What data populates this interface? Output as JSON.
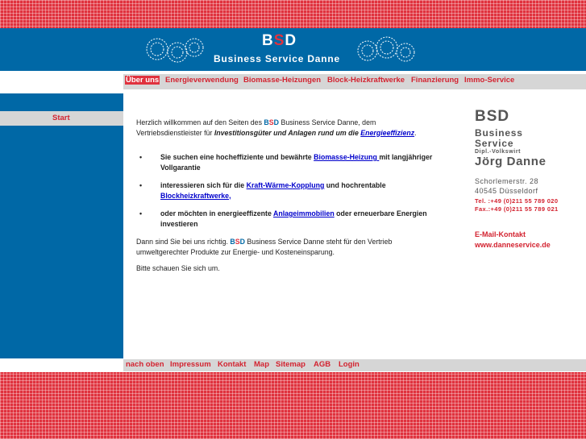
{
  "header": {
    "logo_b": "B",
    "logo_s": "S",
    "logo_d": "D",
    "company": "Business Service Danne"
  },
  "nav": {
    "items": [
      "Über uns",
      "Energieverwendung",
      "Biomasse-Heizungen",
      "Block-Heizkraftwerke",
      "Finanzierung",
      "Immo-Service"
    ],
    "active": "Über uns"
  },
  "sidebar": {
    "start": "Start"
  },
  "content": {
    "intro_1": "Herzlich willkommen auf den Seiten des ",
    "intro_bsd_b": "B",
    "intro_bsd_s": "S",
    "intro_bsd_d": "D",
    "intro_2": " Business Service Danne, dem Vertriebsdienstleister für ",
    "intro_em": "Investitionsgüter und Anlagen rund um die ",
    "intro_link": "Energieeffizienz",
    "intro_end": ".",
    "bullet": "•",
    "b1_pre": "Sie suchen eine hocheffiziente und bewährte ",
    "b1_link": "Biomasse-Heizung ",
    "b1_post": "mit langjähriger Vollgarantie",
    "b2_pre": "interessieren sich für die ",
    "b2_link1": "Kraft-Wärme-Kopplung",
    "b2_mid": " und hochrentable ",
    "b2_link2": "Blockheizkraftwerke,",
    "b3_pre": "oder möchten in energieeffizente ",
    "b3_link": "Anlageimmobilien",
    "b3_post": " oder erneuerbare Energien investieren",
    "p2_pre": "Dann sind Sie bei uns richtig. ",
    "p2_bsd_b": "B",
    "p2_bsd_s": "S",
    "p2_bsd_d": "D",
    "p2_post": " Business Service Danne steht für den Vertrieb umweltgerechter Produkte zur Energie- und Kosteneinsparung.",
    "p3": "Bitte schauen Sie sich um."
  },
  "contact": {
    "bsd": "BSD",
    "business": "Business",
    "service": "Service",
    "title": "Dipl.-Volkswirt",
    "name": "Jörg Danne",
    "street": "Schorlemerstr. 28",
    "city": "40545 Düsseldorf",
    "tel": "Tel. :+49 (0)211 55 789 020",
    "fax": "Fax.:+49 (0)211 55 789 021",
    "email_label": "E-Mail-Kontakt",
    "web": "www.danneservice.de"
  },
  "footer": {
    "items": [
      "nach oben",
      "Impressum",
      "Kontakt",
      "Map",
      "Sitemap",
      "AGB",
      "Login"
    ]
  },
  "colors": {
    "blue": "#0068a6",
    "red": "#e0323e",
    "gray": "#d6d6d6"
  }
}
